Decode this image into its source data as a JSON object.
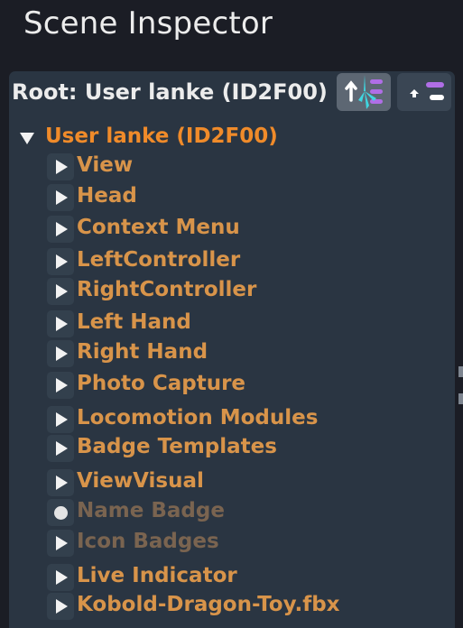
{
  "window": {
    "title": "Scene Inspector"
  },
  "root_bar": {
    "label": "Root: User lanke (ID2F00)",
    "buttons": [
      {
        "name": "set-root-to-selected",
        "icon": "arrow-up-with-children-icon"
      },
      {
        "name": "go-up",
        "icon": "arrow-up-icon"
      }
    ]
  },
  "tree": {
    "root": {
      "label": "User lanke (ID2F00)",
      "expanded": true
    },
    "children": [
      {
        "label": "View",
        "state": "collapsed",
        "enabled": true
      },
      {
        "label": "Head",
        "state": "collapsed",
        "enabled": true
      },
      {
        "label": "Context Menu",
        "state": "collapsed",
        "enabled": true
      },
      {
        "label": "LeftController",
        "state": "collapsed",
        "enabled": true
      },
      {
        "label": "RightController",
        "state": "collapsed",
        "enabled": true
      },
      {
        "label": "Left Hand",
        "state": "collapsed",
        "enabled": true
      },
      {
        "label": "Right Hand",
        "state": "collapsed",
        "enabled": true
      },
      {
        "label": "Photo Capture",
        "state": "collapsed",
        "enabled": true
      },
      {
        "label": "Locomotion Modules",
        "state": "collapsed",
        "enabled": true
      },
      {
        "label": "Badge Templates",
        "state": "collapsed",
        "enabled": true
      },
      {
        "label": "ViewVisual",
        "state": "collapsed",
        "enabled": true
      },
      {
        "label": "Name Badge",
        "state": "leaf",
        "enabled": false
      },
      {
        "label": "Icon Badges",
        "state": "collapsed",
        "enabled": false
      },
      {
        "label": "Live Indicator",
        "state": "collapsed",
        "enabled": true
      },
      {
        "label": "Kobold-Dragon-Toy.fbx",
        "state": "collapsed",
        "enabled": true
      }
    ]
  },
  "colors": {
    "background": "#1b1d25",
    "panel": "#2a3542",
    "label_enabled": "#d8944a",
    "label_disabled": "#7a6450",
    "root_item": "#f08b2a",
    "accent_cyan": "#3fd6e0",
    "accent_purple": "#b06ee6"
  }
}
